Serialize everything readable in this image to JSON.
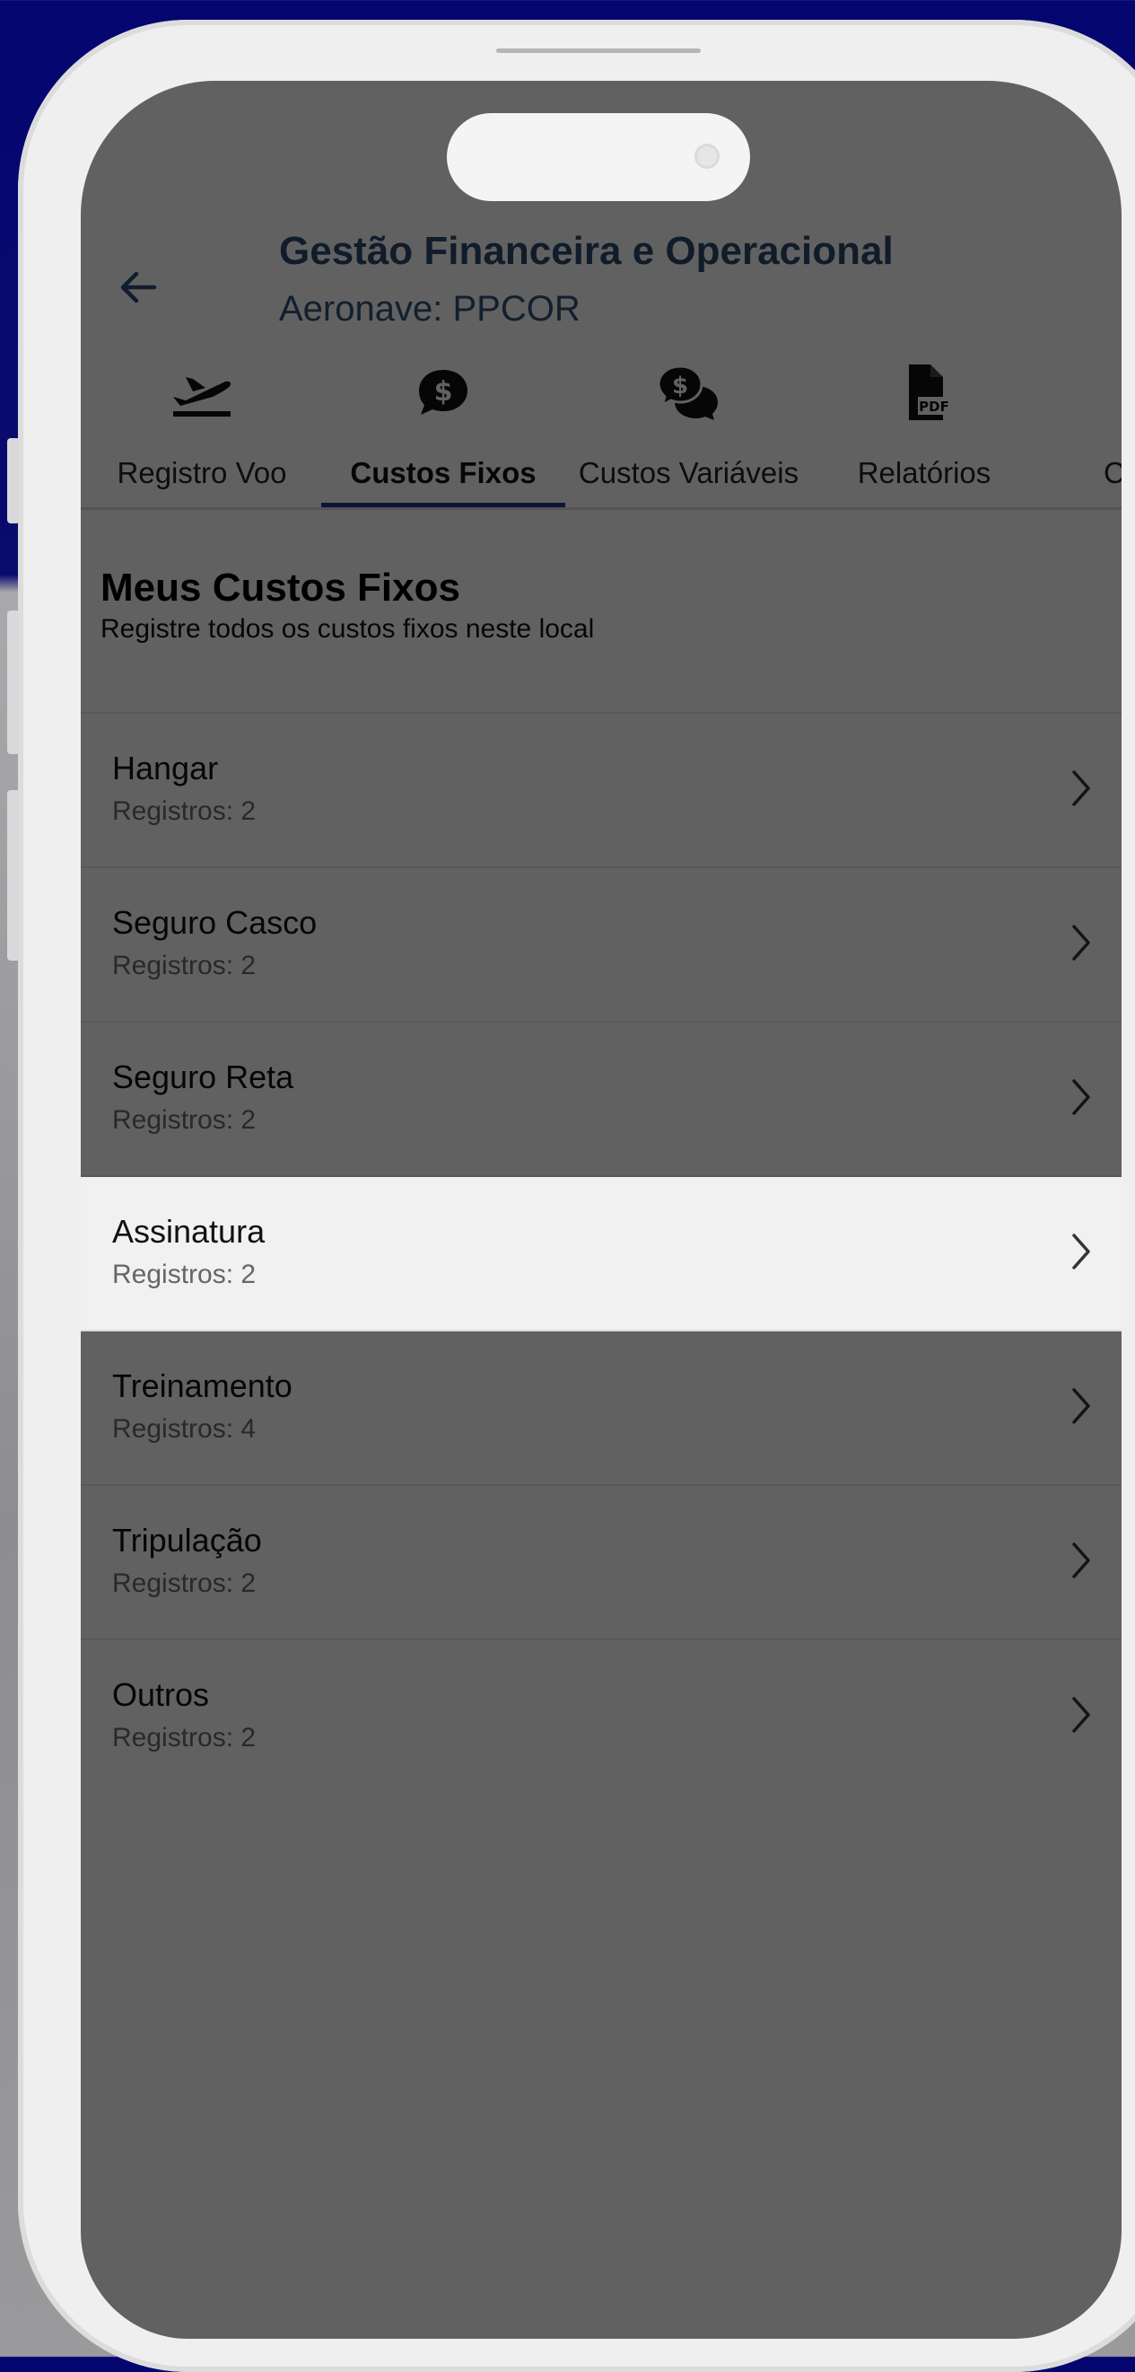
{
  "header": {
    "title": "Gestão Financeira e Operacional",
    "subtitle": "Aeronave: PPCOR"
  },
  "tabs": [
    {
      "label": "Registro Voo",
      "icon": "airplane-departure-icon"
    },
    {
      "label": "Custos Fixos",
      "icon": "dollar-chat-icon",
      "active": true
    },
    {
      "label": "Custos Variáveis",
      "icon": "dollar-chats-icon"
    },
    {
      "label": "Relatórios",
      "icon": "pdf-file-icon"
    }
  ],
  "section": {
    "title": "Meus Custos Fixos",
    "subtitle": "Registre todos os custos fixos neste local"
  },
  "items": [
    {
      "name": "Hangar",
      "count": "Registros: 2"
    },
    {
      "name": "Seguro Casco",
      "count": "Registros: 2"
    },
    {
      "name": "Seguro Reta",
      "count": "Registros: 2"
    },
    {
      "name": "Assinatura",
      "count": "Registros: 2",
      "highlighted": true
    },
    {
      "name": "Treinamento",
      "count": "Registros: 4"
    },
    {
      "name": "Tripulação",
      "count": "Registros: 2"
    },
    {
      "name": "Outros",
      "count": "Registros: 2"
    }
  ],
  "colors": {
    "accent": "#1d3a8a",
    "title": "#284766",
    "overlay": "rgba(0,0,0,0.6)"
  }
}
